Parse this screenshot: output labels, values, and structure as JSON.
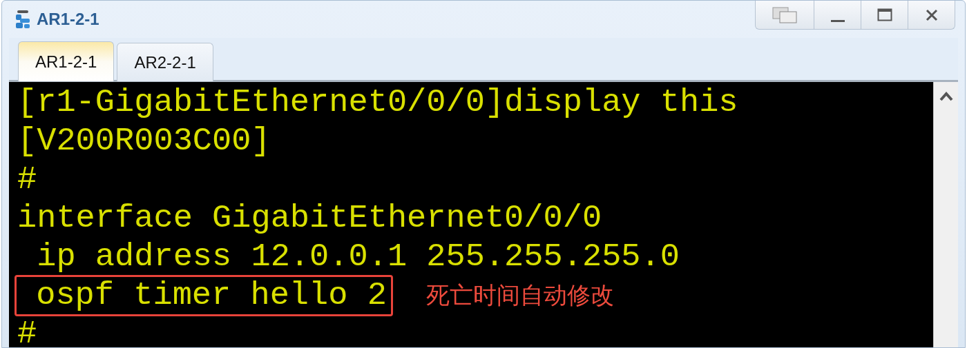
{
  "window": {
    "title": "AR1-2-1"
  },
  "tabs": [
    {
      "label": "AR1-2-1",
      "selected": true
    },
    {
      "label": "AR2-2-1",
      "selected": false
    }
  ],
  "terminal": {
    "lines": [
      {
        "text": "[r1-GigabitEthernet0/0/0]display this",
        "highlighted": false
      },
      {
        "text": "[V200R003C00]",
        "highlighted": false
      },
      {
        "text": "#",
        "highlighted": false
      },
      {
        "text": "interface GigabitEthernet0/0/0",
        "highlighted": false
      },
      {
        "text": " ip address 12.0.0.1 255.255.255.0",
        "highlighted": false
      },
      {
        "text": " ospf timer hello 2",
        "highlighted": true,
        "note": "死亡时间自动修改"
      },
      {
        "text": "#",
        "highlighted": false
      }
    ]
  }
}
